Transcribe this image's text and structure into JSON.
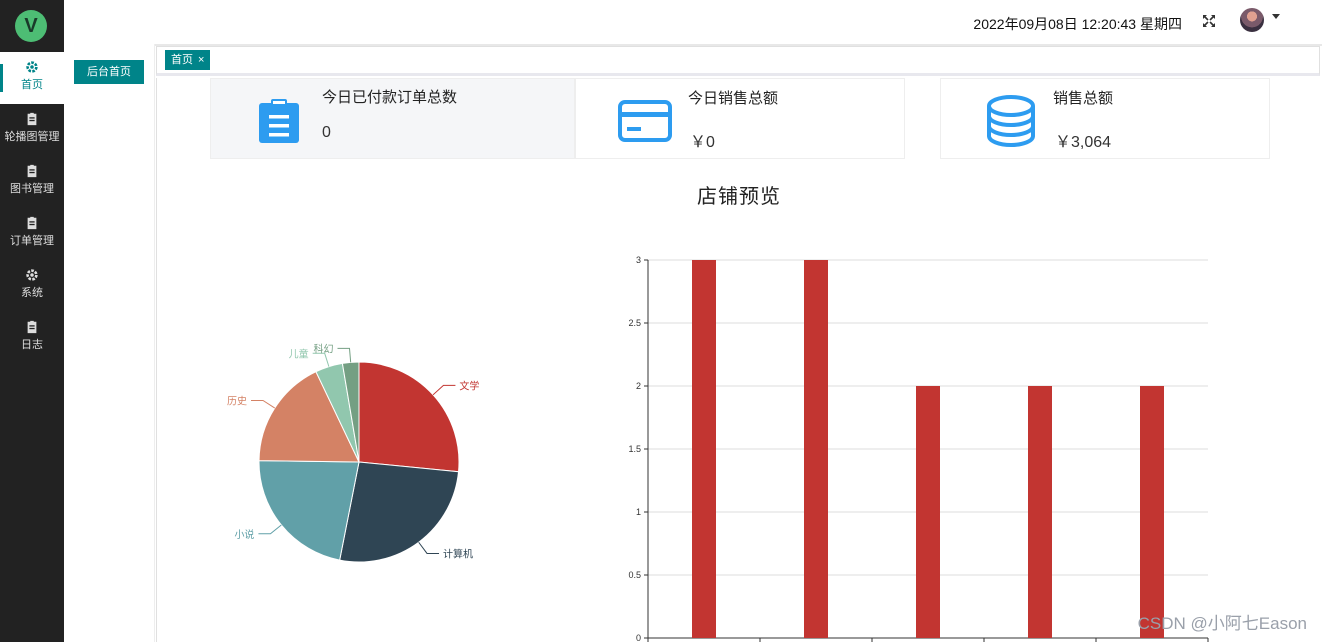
{
  "header": {
    "datetime": "2022年09月08日 12:20:43 星期四"
  },
  "sidebar": {
    "logo_letter": "V",
    "items": [
      {
        "label": "首页",
        "icon": "gear-icon",
        "active": true
      },
      {
        "label": "轮播图管理",
        "icon": "file-icon",
        "active": false
      },
      {
        "label": "图书管理",
        "icon": "file-icon",
        "active": false
      },
      {
        "label": "订单管理",
        "icon": "file-icon",
        "active": false
      },
      {
        "label": "系统",
        "icon": "gear-icon",
        "active": false
      },
      {
        "label": "日志",
        "icon": "file-icon",
        "active": false
      }
    ]
  },
  "subnav": {
    "button": "后台首页"
  },
  "tabs": [
    {
      "label": "首页",
      "close": "×"
    }
  ],
  "cards": [
    {
      "label": "今日已付款订单总数",
      "value": "0",
      "icon": "clipboard-icon"
    },
    {
      "label": "今日销售总额",
      "value": "￥0",
      "icon": "credit-card-icon"
    },
    {
      "label": "销售总额",
      "value": "￥3,064",
      "icon": "coins-stack-icon"
    }
  ],
  "chart_title": "店铺预览",
  "watermark": "CSDN @小阿七Eason",
  "colors": {
    "accent": "#008489",
    "card_icon": "#2d9cf0"
  },
  "chart_data": [
    {
      "type": "pie",
      "slices": [
        {
          "label": "文学",
          "value": 3,
          "color": "#c23531"
        },
        {
          "label": "计算机",
          "value": 3,
          "color": "#2f4554"
        },
        {
          "label": "小说",
          "value": 2.5,
          "color": "#61a0a8"
        },
        {
          "label": "历史",
          "value": 2,
          "color": "#d48265"
        },
        {
          "label": "儿童",
          "value": 0.5,
          "color": "#91c7ae"
        },
        {
          "label": "科幻",
          "value": 0.3,
          "color": "#749f83"
        }
      ]
    },
    {
      "type": "bar",
      "values": [
        3,
        3,
        2,
        2,
        2
      ],
      "ylim": [
        0,
        3
      ],
      "yticks": [
        "0",
        "0.5",
        "1",
        "1.5",
        "2",
        "2.5",
        "3"
      ],
      "color": "#c23531",
      "grid": true
    }
  ]
}
